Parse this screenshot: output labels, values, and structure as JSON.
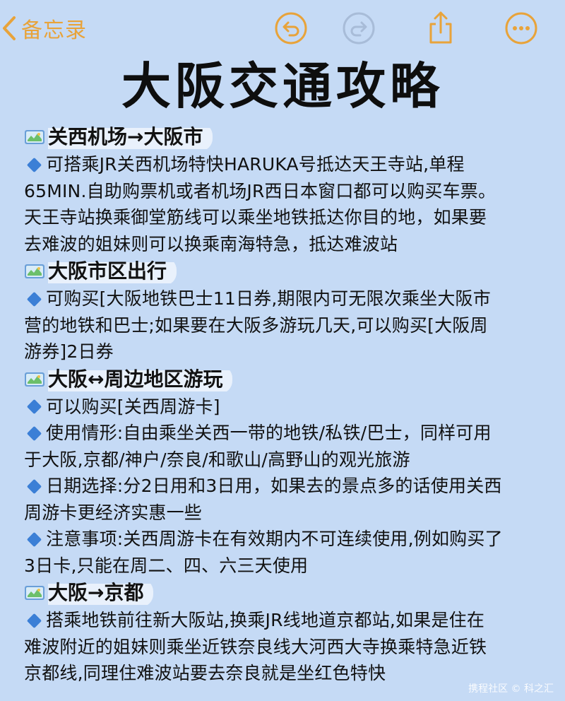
{
  "toolbar": {
    "back_label": "备忘录",
    "colors": {
      "accent": "#e8a33a",
      "disabled": "#a8bcd8"
    }
  },
  "title": "大阪交通攻略",
  "sections": [
    {
      "title": "关西机场→大阪市",
      "paragraphs": [
        {
          "bullet": true,
          "lines": [
            "可搭乘JR关西机场特快HARUKA号抵达天王寺站,单程",
            "65MIN.自助购票机或者机场JR西日本窗口都可以购买车票。",
            "天王寺站换乘御堂筋线可以乘坐地铁抵达你目的地，如果要",
            "去难波的姐妹则可以换乘南海特急，抵达难波站"
          ]
        }
      ]
    },
    {
      "title": "大阪市区出行",
      "paragraphs": [
        {
          "bullet": true,
          "lines": [
            "可购买[大阪地铁巴士11日券,期限内可无限次乘坐大阪市",
            "营的地铁和巴士;如果要在大阪多游玩几天,可以购买[大阪周",
            "游券]2日券"
          ]
        }
      ]
    },
    {
      "title": "大阪↔周边地区游玩",
      "paragraphs": [
        {
          "bullet": true,
          "lines": [
            "可以购买[关西周游卡]"
          ]
        },
        {
          "bullet": true,
          "lines": [
            "使用情形:自由乘坐关西一带的地铁/私铁/巴士，同样可用",
            "于大阪,京都/神户/奈良/和歌山/高野山的观光旅游"
          ]
        },
        {
          "bullet": true,
          "lines": [
            "日期选择:分2日用和3日用，如果去的景点多的话使用关西",
            "周游卡更经济实惠一些"
          ]
        },
        {
          "bullet": true,
          "lines": [
            "注意事项:关西周游卡在有效期内不可连续使用,例如购买了",
            "3日卡,只能在周二、四、六三天使用"
          ]
        }
      ]
    },
    {
      "title": "大阪→京都",
      "paragraphs": [
        {
          "bullet": true,
          "lines": [
            "搭乘地铁前往新大阪站,换乘JR线地道京都站,如果是住在",
            "难波附近的姐妹则乘坐近铁奈良线大河西大寺换乘特急近铁",
            "京都线,同理住难波站要去奈良就是坐红色特快"
          ]
        }
      ]
    }
  ],
  "watermark": "携程社区 © 科之汇"
}
